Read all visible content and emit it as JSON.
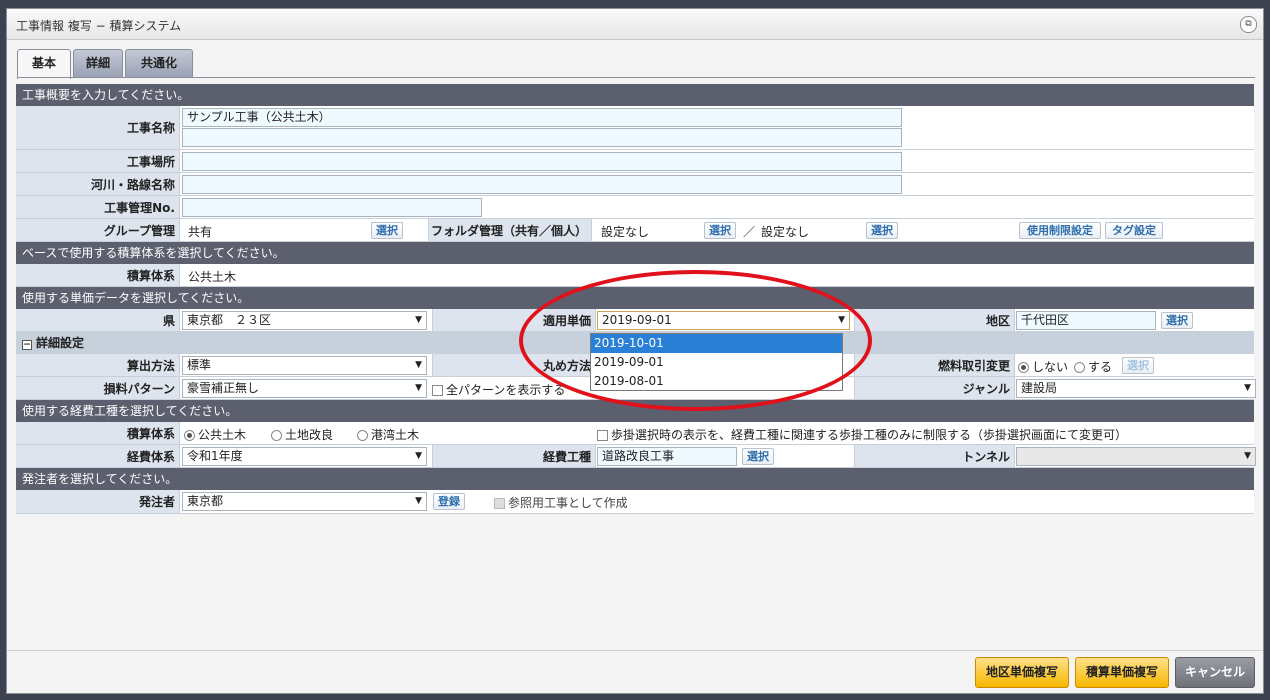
{
  "window": {
    "title": "工事情報 複写 − 積算システム"
  },
  "tabs": [
    "基本",
    "詳細",
    "共通化"
  ],
  "sections": {
    "overview": "工事概要を入力してください。",
    "base": "ベースで使用する積算体系を選択してください。",
    "unitprice": "使用する単価データを選択してください。",
    "detail": "詳細設定",
    "expense": "使用する経費工種を選択してください。",
    "orderer": "発注者を選択してください。"
  },
  "overview": {
    "name_label": "工事名称",
    "name_value": "サンプル工事（公共土木）",
    "place_label": "工事場所",
    "river_label": "河川・路線名称",
    "mgmt_label": "工事管理No.",
    "group_label": "グループ管理",
    "group_value": "共有",
    "folder_label": "フォルダ管理（共有／個人）",
    "folder_value1": "設定なし",
    "folder_sep": "／",
    "folder_value2": "設定なし",
    "select_btn": "選択",
    "limit_btn": "使用制限設定",
    "tag_btn": "タグ設定"
  },
  "base": {
    "label": "積算体系",
    "value": "公共土木"
  },
  "unitprice": {
    "pref_label": "県",
    "pref_value": "東京都　２３区",
    "apply_label": "適用単価",
    "apply_value": "2019-09-01",
    "region_label": "地区",
    "region_value": "千代田区",
    "options": [
      "2019-10-01",
      "2019-09-01",
      "2019-08-01"
    ]
  },
  "detail": {
    "calc_label": "算出方法",
    "calc_value": "標準",
    "round_label": "丸め方法",
    "fuel_label": "燃料取引変更",
    "fuel_no": "しない",
    "fuel_yes": "する",
    "loss_label": "損料パターン",
    "loss_value": "豪雪補正無し",
    "all_pattern": "全パターンを表示する",
    "genre_label": "ジャンル",
    "genre_value": "建設局"
  },
  "expense": {
    "system_label": "積算体系",
    "opt1": "公共土木",
    "opt2": "土地改良",
    "opt3": "港湾土木",
    "note": "歩掛選択時の表示を、経費工種に関連する歩掛工種のみに制限する（歩掛選択画面にて変更可）",
    "exp_label": "経費体系",
    "exp_value": "令和1年度",
    "kind_label": "経費工種",
    "kind_value": "道路改良工事",
    "tunnel_label": "トンネル"
  },
  "orderer": {
    "label": "発注者",
    "value": "東京都",
    "register_btn": "登録",
    "ref_label": "参照用工事として作成"
  },
  "footer": {
    "region_copy": "地区単価複写",
    "unit_copy": "積算単価複写",
    "cancel": "キャンセル"
  }
}
